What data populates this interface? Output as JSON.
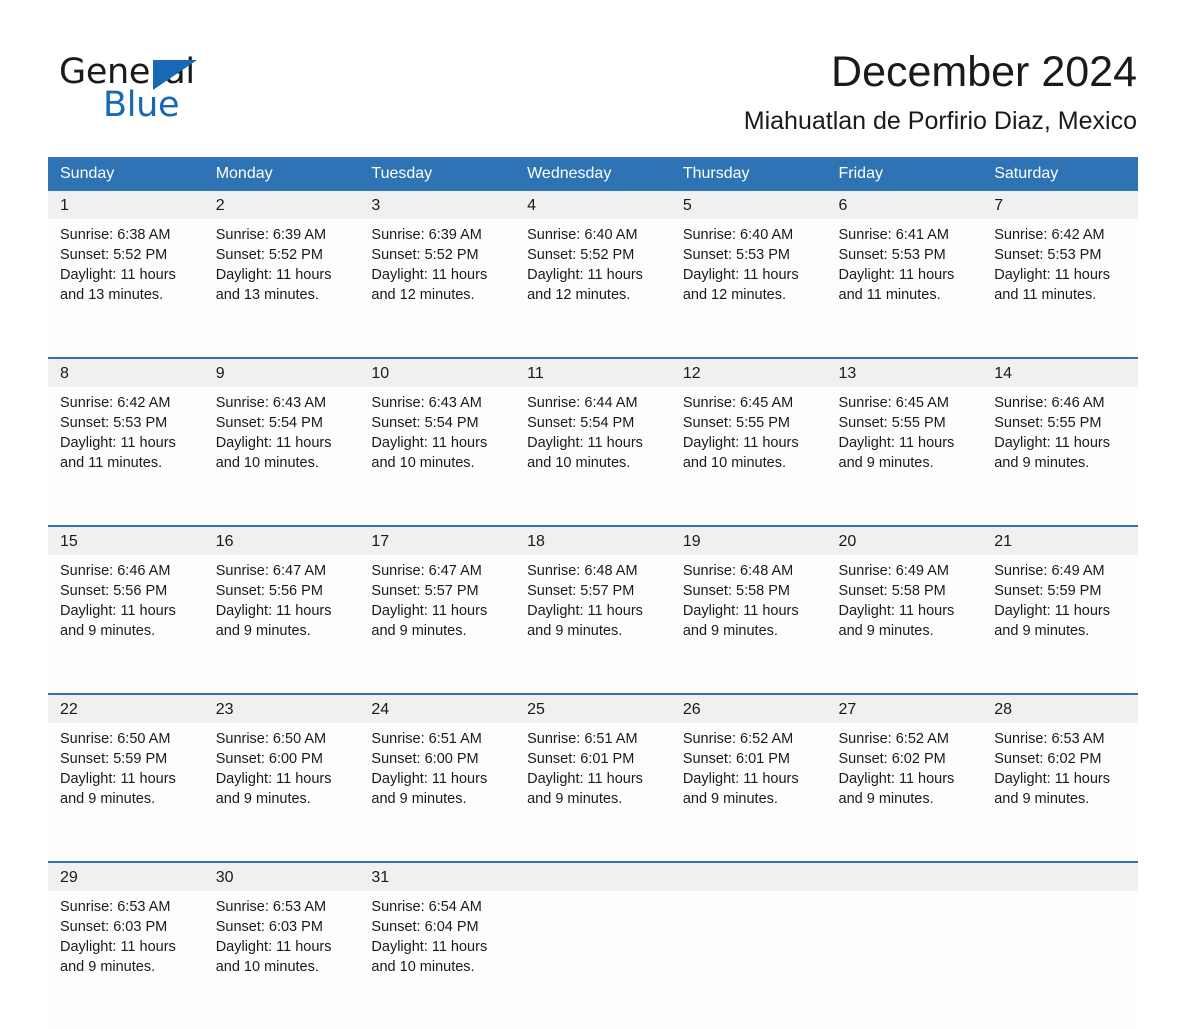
{
  "brand": {
    "name_part1": "General",
    "name_part2": "Blue",
    "triangle_color": "#1669b5"
  },
  "header": {
    "month_title": "December 2024",
    "location": "Miahuatlan de Porfirio Diaz, Mexico",
    "header_bg": "#2e74b5",
    "daynumber_bg": "#f0f0f0"
  },
  "weekday_headers": [
    "Sunday",
    "Monday",
    "Tuesday",
    "Wednesday",
    "Thursday",
    "Friday",
    "Saturday"
  ],
  "weeks": [
    {
      "numbers": [
        "1",
        "2",
        "3",
        "4",
        "5",
        "6",
        "7"
      ],
      "days": [
        {
          "sunrise": "Sunrise: 6:38 AM",
          "sunset": "Sunset: 5:52 PM",
          "daylight_1": "Daylight: 11 hours",
          "daylight_2": "and 13 minutes."
        },
        {
          "sunrise": "Sunrise: 6:39 AM",
          "sunset": "Sunset: 5:52 PM",
          "daylight_1": "Daylight: 11 hours",
          "daylight_2": "and 13 minutes."
        },
        {
          "sunrise": "Sunrise: 6:39 AM",
          "sunset": "Sunset: 5:52 PM",
          "daylight_1": "Daylight: 11 hours",
          "daylight_2": "and 12 minutes."
        },
        {
          "sunrise": "Sunrise: 6:40 AM",
          "sunset": "Sunset: 5:52 PM",
          "daylight_1": "Daylight: 11 hours",
          "daylight_2": "and 12 minutes."
        },
        {
          "sunrise": "Sunrise: 6:40 AM",
          "sunset": "Sunset: 5:53 PM",
          "daylight_1": "Daylight: 11 hours",
          "daylight_2": "and 12 minutes."
        },
        {
          "sunrise": "Sunrise: 6:41 AM",
          "sunset": "Sunset: 5:53 PM",
          "daylight_1": "Daylight: 11 hours",
          "daylight_2": "and 11 minutes."
        },
        {
          "sunrise": "Sunrise: 6:42 AM",
          "sunset": "Sunset: 5:53 PM",
          "daylight_1": "Daylight: 11 hours",
          "daylight_2": "and 11 minutes."
        }
      ]
    },
    {
      "numbers": [
        "8",
        "9",
        "10",
        "11",
        "12",
        "13",
        "14"
      ],
      "days": [
        {
          "sunrise": "Sunrise: 6:42 AM",
          "sunset": "Sunset: 5:53 PM",
          "daylight_1": "Daylight: 11 hours",
          "daylight_2": "and 11 minutes."
        },
        {
          "sunrise": "Sunrise: 6:43 AM",
          "sunset": "Sunset: 5:54 PM",
          "daylight_1": "Daylight: 11 hours",
          "daylight_2": "and 10 minutes."
        },
        {
          "sunrise": "Sunrise: 6:43 AM",
          "sunset": "Sunset: 5:54 PM",
          "daylight_1": "Daylight: 11 hours",
          "daylight_2": "and 10 minutes."
        },
        {
          "sunrise": "Sunrise: 6:44 AM",
          "sunset": "Sunset: 5:54 PM",
          "daylight_1": "Daylight: 11 hours",
          "daylight_2": "and 10 minutes."
        },
        {
          "sunrise": "Sunrise: 6:45 AM",
          "sunset": "Sunset: 5:55 PM",
          "daylight_1": "Daylight: 11 hours",
          "daylight_2": "and 10 minutes."
        },
        {
          "sunrise": "Sunrise: 6:45 AM",
          "sunset": "Sunset: 5:55 PM",
          "daylight_1": "Daylight: 11 hours",
          "daylight_2": "and 9 minutes."
        },
        {
          "sunrise": "Sunrise: 6:46 AM",
          "sunset": "Sunset: 5:55 PM",
          "daylight_1": "Daylight: 11 hours",
          "daylight_2": "and 9 minutes."
        }
      ]
    },
    {
      "numbers": [
        "15",
        "16",
        "17",
        "18",
        "19",
        "20",
        "21"
      ],
      "days": [
        {
          "sunrise": "Sunrise: 6:46 AM",
          "sunset": "Sunset: 5:56 PM",
          "daylight_1": "Daylight: 11 hours",
          "daylight_2": "and 9 minutes."
        },
        {
          "sunrise": "Sunrise: 6:47 AM",
          "sunset": "Sunset: 5:56 PM",
          "daylight_1": "Daylight: 11 hours",
          "daylight_2": "and 9 minutes."
        },
        {
          "sunrise": "Sunrise: 6:47 AM",
          "sunset": "Sunset: 5:57 PM",
          "daylight_1": "Daylight: 11 hours",
          "daylight_2": "and 9 minutes."
        },
        {
          "sunrise": "Sunrise: 6:48 AM",
          "sunset": "Sunset: 5:57 PM",
          "daylight_1": "Daylight: 11 hours",
          "daylight_2": "and 9 minutes."
        },
        {
          "sunrise": "Sunrise: 6:48 AM",
          "sunset": "Sunset: 5:58 PM",
          "daylight_1": "Daylight: 11 hours",
          "daylight_2": "and 9 minutes."
        },
        {
          "sunrise": "Sunrise: 6:49 AM",
          "sunset": "Sunset: 5:58 PM",
          "daylight_1": "Daylight: 11 hours",
          "daylight_2": "and 9 minutes."
        },
        {
          "sunrise": "Sunrise: 6:49 AM",
          "sunset": "Sunset: 5:59 PM",
          "daylight_1": "Daylight: 11 hours",
          "daylight_2": "and 9 minutes."
        }
      ]
    },
    {
      "numbers": [
        "22",
        "23",
        "24",
        "25",
        "26",
        "27",
        "28"
      ],
      "days": [
        {
          "sunrise": "Sunrise: 6:50 AM",
          "sunset": "Sunset: 5:59 PM",
          "daylight_1": "Daylight: 11 hours",
          "daylight_2": "and 9 minutes."
        },
        {
          "sunrise": "Sunrise: 6:50 AM",
          "sunset": "Sunset: 6:00 PM",
          "daylight_1": "Daylight: 11 hours",
          "daylight_2": "and 9 minutes."
        },
        {
          "sunrise": "Sunrise: 6:51 AM",
          "sunset": "Sunset: 6:00 PM",
          "daylight_1": "Daylight: 11 hours",
          "daylight_2": "and 9 minutes."
        },
        {
          "sunrise": "Sunrise: 6:51 AM",
          "sunset": "Sunset: 6:01 PM",
          "daylight_1": "Daylight: 11 hours",
          "daylight_2": "and 9 minutes."
        },
        {
          "sunrise": "Sunrise: 6:52 AM",
          "sunset": "Sunset: 6:01 PM",
          "daylight_1": "Daylight: 11 hours",
          "daylight_2": "and 9 minutes."
        },
        {
          "sunrise": "Sunrise: 6:52 AM",
          "sunset": "Sunset: 6:02 PM",
          "daylight_1": "Daylight: 11 hours",
          "daylight_2": "and 9 minutes."
        },
        {
          "sunrise": "Sunrise: 6:53 AM",
          "sunset": "Sunset: 6:02 PM",
          "daylight_1": "Daylight: 11 hours",
          "daylight_2": "and 9 minutes."
        }
      ]
    },
    {
      "numbers": [
        "29",
        "30",
        "31",
        "",
        "",
        "",
        ""
      ],
      "days": [
        {
          "sunrise": "Sunrise: 6:53 AM",
          "sunset": "Sunset: 6:03 PM",
          "daylight_1": "Daylight: 11 hours",
          "daylight_2": "and 9 minutes."
        },
        {
          "sunrise": "Sunrise: 6:53 AM",
          "sunset": "Sunset: 6:03 PM",
          "daylight_1": "Daylight: 11 hours",
          "daylight_2": "and 10 minutes."
        },
        {
          "sunrise": "Sunrise: 6:54 AM",
          "sunset": "Sunset: 6:04 PM",
          "daylight_1": "Daylight: 11 hours",
          "daylight_2": "and 10 minutes."
        },
        {
          "sunrise": "",
          "sunset": "",
          "daylight_1": "",
          "daylight_2": ""
        },
        {
          "sunrise": "",
          "sunset": "",
          "daylight_1": "",
          "daylight_2": ""
        },
        {
          "sunrise": "",
          "sunset": "",
          "daylight_1": "",
          "daylight_2": ""
        },
        {
          "sunrise": "",
          "sunset": "",
          "daylight_1": "",
          "daylight_2": ""
        }
      ]
    }
  ]
}
